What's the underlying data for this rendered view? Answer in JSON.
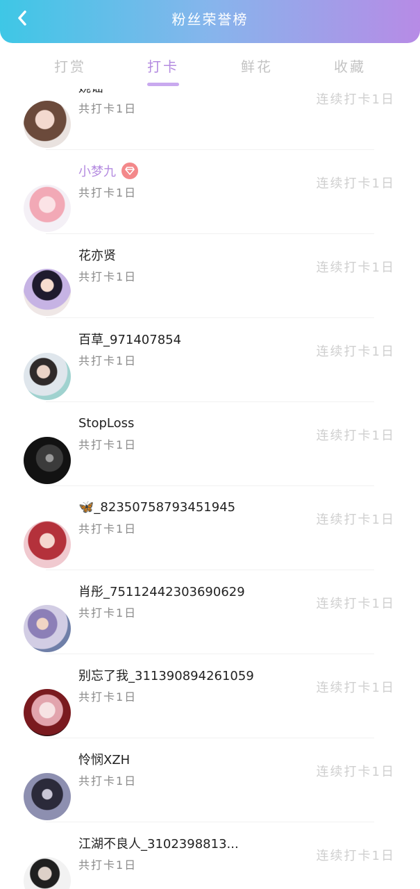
{
  "header": {
    "title": "粉丝荣誉榜"
  },
  "tabs": [
    {
      "label": "打赏",
      "active": false
    },
    {
      "label": "打卡",
      "active": true
    },
    {
      "label": "鲜花",
      "active": false
    },
    {
      "label": "收藏",
      "active": false
    }
  ],
  "colors": {
    "accent": "#b48be0",
    "header_gradient_start": "#3ec7e6",
    "header_gradient_end": "#b78be6",
    "vip_badge": "#f3888a"
  },
  "fans": [
    {
      "name": "婉谣",
      "sub": "共打卡1日",
      "streak": "连续打卡1日",
      "vip": false,
      "avatar": "girl-photo-avatar"
    },
    {
      "name": "小梦九",
      "sub": "共打卡1日",
      "streak": "连续打卡1日",
      "vip": true,
      "avatar": "anime-girl-avatar"
    },
    {
      "name": "花亦贤",
      "sub": "共打卡1日",
      "streak": "连续打卡1日",
      "vip": false,
      "avatar": "anime-costume-avatar"
    },
    {
      "name": "百草_971407854",
      "sub": "共打卡1日",
      "streak": "连续打卡1日",
      "vip": false,
      "avatar": "pillow-girl-avatar"
    },
    {
      "name": "StopLoss",
      "sub": "共打卡1日",
      "streak": "连续打卡1日",
      "vip": false,
      "avatar": "dark-scene-avatar"
    },
    {
      "name": "🦋_82350758793451945",
      "sub": "共打卡1日",
      "streak": "连续打卡1日",
      "vip": false,
      "avatar": "red-hair-girl-avatar"
    },
    {
      "name": "肖彤_75112442303690629",
      "sub": "共打卡1日",
      "streak": "连续打卡1日",
      "vip": false,
      "avatar": "kids-group-avatar"
    },
    {
      "name": "别忘了我_311390894261059",
      "sub": "共打卡1日",
      "streak": "连续打卡1日",
      "vip": false,
      "avatar": "anime-cat-girl-avatar"
    },
    {
      "name": "怜悯XZH",
      "sub": "共打卡1日",
      "streak": "连续打卡1日",
      "vip": false,
      "avatar": "blurred-face-avatar"
    },
    {
      "name": "江湖不良人_3102398813...",
      "sub": "共打卡1日",
      "streak": "连续打卡1日",
      "vip": false,
      "avatar": "boy-tshirt-avatar"
    }
  ]
}
